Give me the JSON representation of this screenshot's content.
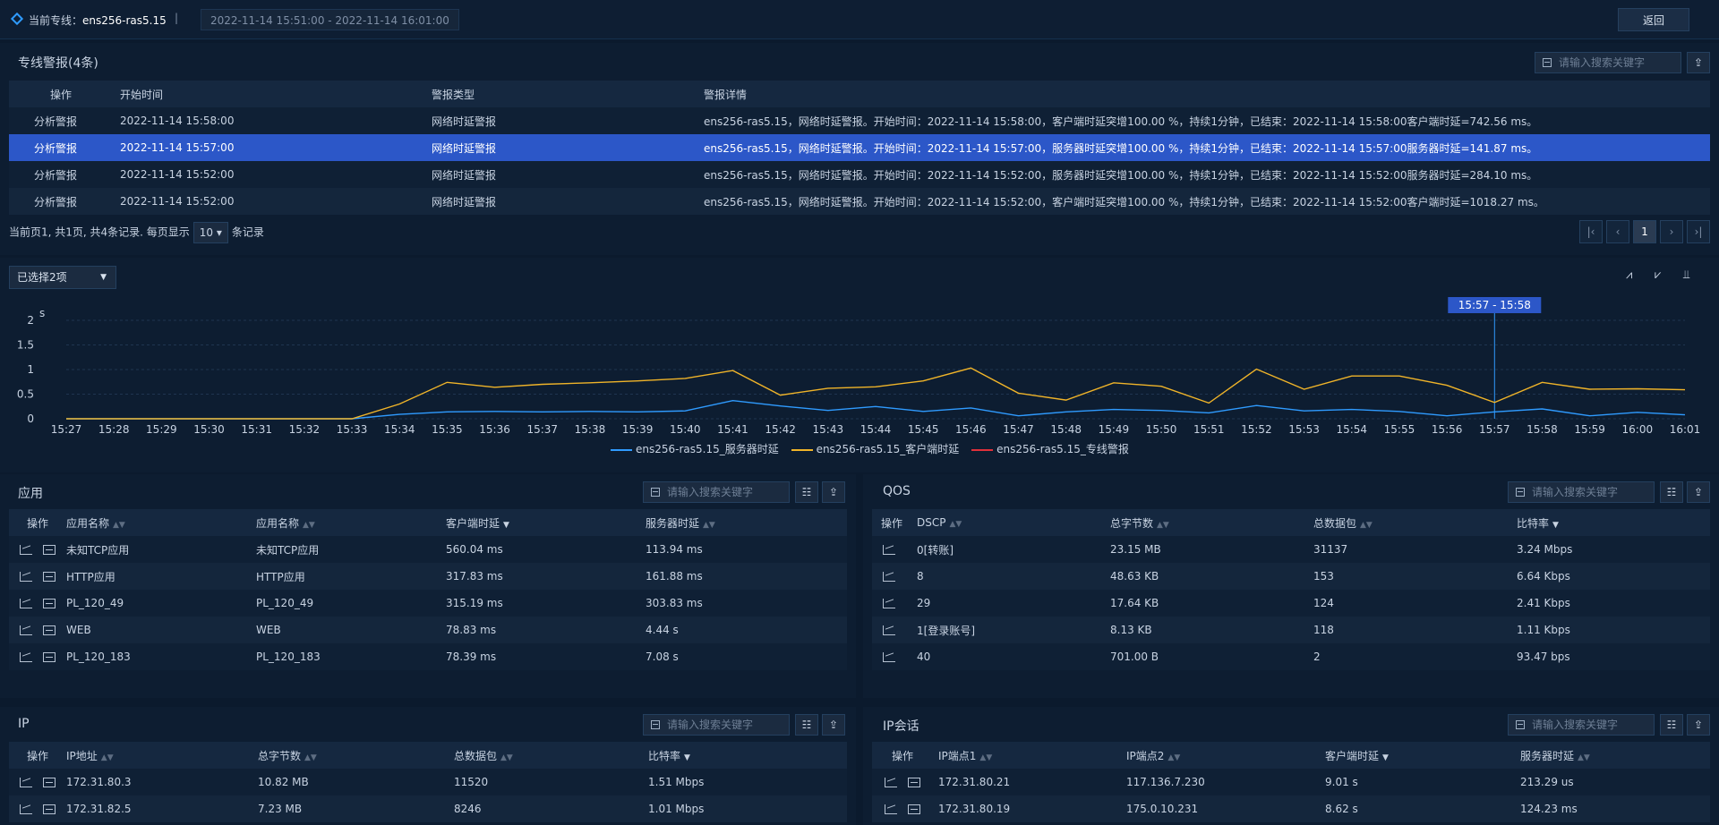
{
  "top": {
    "label": "当前专线：",
    "line": "ens256-ras5.15",
    "sep": "|",
    "range": "2022-11-14 15:51:00 - 2022-11-14 16:01:00",
    "back": "返回"
  },
  "alarm": {
    "title": "专线警报(4条)",
    "search": "请输入搜索关键字",
    "cols": [
      "操作",
      "开始时间",
      "警报类型",
      "警报详情"
    ],
    "rows": [
      [
        "分析警报",
        "2022-11-14 15:58:00",
        "网络时延警报",
        "ens256-ras5.15，网络时延警报。开始时间：2022-11-14 15:58:00，客户端时延突增100.00 %，持续1分钟，已结束：2022-11-14 15:58:00客户端时延=742.56 ms。"
      ],
      [
        "分析警报",
        "2022-11-14 15:57:00",
        "网络时延警报",
        "ens256-ras5.15，网络时延警报。开始时间：2022-11-14 15:57:00，服务器时延突增100.00 %，持续1分钟，已结束：2022-11-14 15:57:00服务器时延=141.87 ms。"
      ],
      [
        "分析警报",
        "2022-11-14 15:52:00",
        "网络时延警报",
        "ens256-ras5.15，网络时延警报。开始时间：2022-11-14 15:52:00，服务器时延突增100.00 %，持续1分钟，已结束：2022-11-14 15:52:00服务器时延=284.10 ms。"
      ],
      [
        "分析警报",
        "2022-11-14 15:52:00",
        "网络时延警报",
        "ens256-ras5.15，网络时延警报。开始时间：2022-11-14 15:52:00，客户端时延突增100.00 %，持续1分钟，已结束：2022-11-14 15:52:00客户端时延=1018.27 ms。"
      ]
    ],
    "pager": {
      "prefix": "当前页1, 共1页, 共4条记录. 每页显示",
      "size": "10",
      "suffix": "条记录",
      "page": "1"
    }
  },
  "selector": {
    "label": "已选择2项"
  },
  "chart_data": {
    "type": "line",
    "yunit": "s",
    "ylim": [
      0,
      2
    ],
    "yticks": [
      "0",
      "0.5",
      "1",
      "1.5",
      "2"
    ],
    "x": [
      "15:27",
      "15:28",
      "15:29",
      "15:30",
      "15:31",
      "15:32",
      "15:33",
      "15:34",
      "15:35",
      "15:36",
      "15:37",
      "15:38",
      "15:39",
      "15:40",
      "15:41",
      "15:42",
      "15:43",
      "15:44",
      "15:45",
      "15:46",
      "15:47",
      "15:48",
      "15:49",
      "15:50",
      "15:51",
      "15:52",
      "15:53",
      "15:54",
      "15:55",
      "15:56",
      "15:57",
      "15:58",
      "15:59",
      "16:00",
      "16:01"
    ],
    "marker": "15:57 - 15:58",
    "series": [
      {
        "name": "ens256-ras5.15_服务器时延",
        "color": "#2f9bff",
        "values": [
          0,
          0,
          0,
          0,
          0,
          0,
          0,
          0.09,
          0.14,
          0.15,
          0.14,
          0.15,
          0.14,
          0.16,
          0.37,
          0.26,
          0.17,
          0.25,
          0.15,
          0.22,
          0.06,
          0.14,
          0.19,
          0.17,
          0.12,
          0.27,
          0.16,
          0.19,
          0.15,
          0.06,
          0.14,
          0.2,
          0.06,
          0.13,
          0.08
        ]
      },
      {
        "name": "ens256-ras5.15_客户端时延",
        "color": "#f0b429",
        "values": [
          0,
          0,
          0,
          0,
          0,
          0,
          0,
          0.3,
          0.74,
          0.64,
          0.7,
          0.73,
          0.77,
          0.82,
          0.98,
          0.48,
          0.62,
          0.65,
          0.77,
          1.03,
          0.52,
          0.38,
          0.73,
          0.66,
          0.32,
          1.01,
          0.6,
          0.87,
          0.87,
          0.68,
          0.33,
          0.74,
          0.6,
          0.61,
          0.59
        ]
      },
      {
        "name": "ens256-ras5.15_专线警报",
        "color": "#e0303a",
        "values": []
      }
    ]
  },
  "app": {
    "title": "应用",
    "search": "请输入搜索关键字",
    "cols": [
      "操作",
      "应用名称",
      "应用名称",
      "客户端时延",
      "服务器时延"
    ],
    "rows": [
      [
        "未知TCP应用",
        "未知TCP应用",
        "560.04 ms",
        "113.94 ms"
      ],
      [
        "HTTP应用",
        "HTTP应用",
        "317.83 ms",
        "161.88 ms"
      ],
      [
        "PL_120_49",
        "PL_120_49",
        "315.19 ms",
        "303.83 ms"
      ],
      [
        "WEB",
        "WEB",
        "78.83 ms",
        "4.44 s"
      ],
      [
        "PL_120_183",
        "PL_120_183",
        "78.39 ms",
        "7.08 s"
      ]
    ]
  },
  "qos": {
    "title": "QOS",
    "search": "请输入搜索关键字",
    "cols": [
      "操作",
      "DSCP",
      "总字节数",
      "总数据包",
      "比特率"
    ],
    "rows": [
      [
        "0[转账]",
        "23.15 MB",
        "31137",
        "3.24 Mbps"
      ],
      [
        "8",
        "48.63 KB",
        "153",
        "6.64 Kbps"
      ],
      [
        "29",
        "17.64 KB",
        "124",
        "2.41 Kbps"
      ],
      [
        "1[登录账号]",
        "8.13 KB",
        "118",
        "1.11 Kbps"
      ],
      [
        "40",
        "701.00 B",
        "2",
        "93.47 bps"
      ]
    ]
  },
  "ip": {
    "title": "IP",
    "search": "请输入搜索关键字",
    "cols": [
      "操作",
      "IP地址",
      "总字节数",
      "总数据包",
      "比特率"
    ],
    "rows": [
      [
        "172.31.80.3",
        "10.82 MB",
        "11520",
        "1.51 Mbps"
      ],
      [
        "172.31.82.5",
        "7.23 MB",
        "8246",
        "1.01 Mbps"
      ]
    ]
  },
  "ipsess": {
    "title": "IP会话",
    "search": "请输入搜索关键字",
    "cols": [
      "操作",
      "IP端点1",
      "IP端点2",
      "客户端时延",
      "服务器时延"
    ],
    "rows": [
      [
        "172.31.80.21",
        "117.136.7.230",
        "9.01 s",
        "213.29 us"
      ],
      [
        "172.31.80.19",
        "175.0.10.231",
        "8.62 s",
        "124.23 ms"
      ]
    ]
  }
}
